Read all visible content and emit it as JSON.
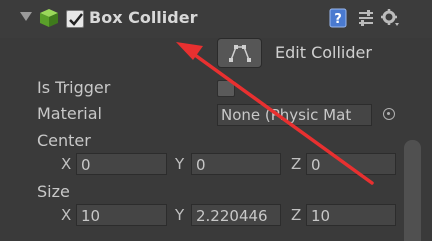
{
  "component": {
    "title": "Box Collider",
    "enabled": true,
    "icons": [
      "collapse-triangle-icon",
      "cube-icon",
      "help-icon",
      "preset-icon",
      "gear-icon"
    ]
  },
  "edit_collider": {
    "label": "Edit Collider",
    "icon": "edit-collider-icon"
  },
  "fields": {
    "is_trigger": {
      "label": "Is Trigger",
      "checked": false
    },
    "material": {
      "label": "Material",
      "value": "None (Physic Mat",
      "picker_icon": "object-picker-icon"
    },
    "center": {
      "label": "Center",
      "x_label": "X",
      "x": "0",
      "y_label": "Y",
      "y": "0",
      "z_label": "Z",
      "z": "0"
    },
    "size": {
      "label": "Size",
      "x_label": "X",
      "x": "10",
      "y_label": "Y",
      "y": "2.220446",
      "z_label": "Z",
      "z": "10"
    }
  },
  "annotation": {
    "type": "red-arrow",
    "color": "#e83030"
  }
}
